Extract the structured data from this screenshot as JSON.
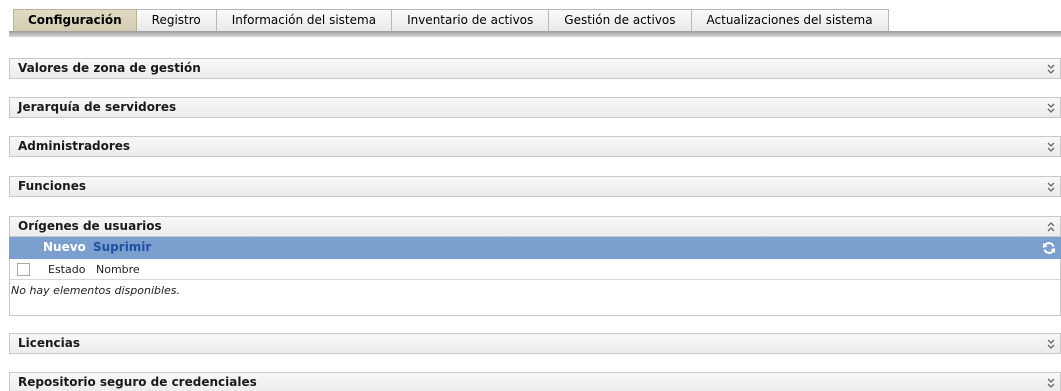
{
  "tabs": [
    {
      "label": "Configuración",
      "active": true
    },
    {
      "label": "Registro",
      "active": false
    },
    {
      "label": "Información del sistema",
      "active": false
    },
    {
      "label": "Inventario de activos",
      "active": false
    },
    {
      "label": "Gestión de activos",
      "active": false
    },
    {
      "label": "Actualizaciones del sistema",
      "active": false
    }
  ],
  "panels": {
    "zona": {
      "title": "Valores de zona de gestión",
      "state": "collapsed",
      "icon": "double-chevron-down-icon"
    },
    "jerarquia": {
      "title": "Jerarquía de servidores",
      "state": "collapsed",
      "icon": "double-chevron-down-icon"
    },
    "administradores": {
      "title": "Administradores",
      "state": "collapsed",
      "icon": "double-chevron-down-icon"
    },
    "funciones": {
      "title": "Funciones",
      "state": "collapsed",
      "icon": "double-chevron-down-icon"
    },
    "origenes": {
      "title": "Orígenes de usuarios",
      "state": "expanded",
      "icon": "double-chevron-up-icon",
      "toolbar": {
        "new_label": "Nuevo",
        "delete_label": "Suprimir",
        "refresh_icon": "refresh-icon"
      },
      "columns": [
        "Estado",
        "Nombre"
      ],
      "empty_message": "No hay elementos disponibles."
    },
    "licencias": {
      "title": "Licencias",
      "state": "collapsed",
      "icon": "double-chevron-down-icon"
    },
    "repositorio": {
      "title": "Repositorio seguro de credenciales",
      "state": "collapsed",
      "icon": "double-chevron-down-icon"
    }
  },
  "colors": {
    "active_tab": "#d8d1b8",
    "toolbar": "#7b9fcf",
    "toolbar_link": "#1f4fa0"
  }
}
